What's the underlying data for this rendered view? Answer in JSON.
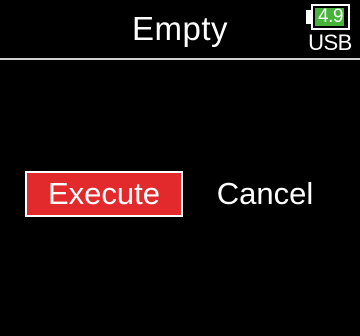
{
  "header": {
    "title": "Empty"
  },
  "power": {
    "battery_value": "4.9",
    "battery_level": 0.92,
    "battery_color": "#46b33a",
    "battery_icon": "battery-icon",
    "source_label": "USB"
  },
  "dialog": {
    "execute_label": "Execute",
    "cancel_label": "Cancel",
    "selected": "execute",
    "selected_color": "#e2292b"
  }
}
